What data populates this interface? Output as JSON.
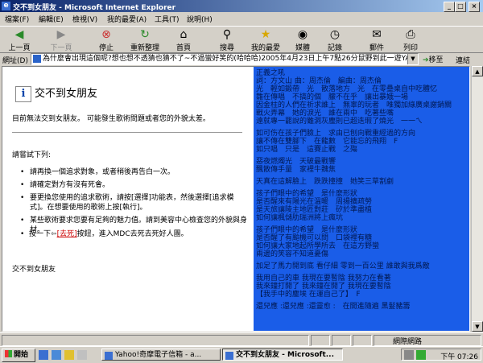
{
  "window": {
    "title": "交不到女朋友 - Microsoft Internet Explorer"
  },
  "menu": [
    "檔案(F)",
    "編輯(E)",
    "檢視(V)",
    "我的最愛(A)",
    "工具(T)",
    "說明(H)"
  ],
  "toolbar": {
    "back": "上一頁",
    "forward": "下一頁",
    "stop": "停止",
    "refresh": "重新整理",
    "home": "首頁",
    "search": "搜尋",
    "favorites": "我的最愛",
    "media": "媒體",
    "history": "記錄",
    "mail": "郵件",
    "print": "列印"
  },
  "address": {
    "label": "網址(D)",
    "value": "為什麼會出現這個呢?想也想不透猜也猜不了~不過蠻好笑的(哈哈哈)2005年4月23日上午7點26分鼠野到此一遊YA",
    "go": "移至",
    "links": "連結"
  },
  "error": {
    "title": "交不到女朋友",
    "message": "目前無法交到女朋友。 可能發生歌術問題或者您的外貌太差。",
    "try_heading": "請嘗試下列:",
    "bullets": [
      "請再換一個追求對象，或者稍後再告白一次。",
      "請確定對方有沒有死會。",
      "要更換您使用的追求歌術，請按[選擇]功能表，然後選擇[追求模式]。在想要使用的歌術上按[執行]。",
      "某些歌術要求您要有足夠的魅力值。請到美容中心檢查您的外貌與身材。"
    ],
    "step_prefix": "按一下",
    "step_button": "[去死]",
    "step_suffix": "按鈕，進入MDC去死去死好人團。",
    "footer": "交不到女朋友"
  },
  "lyrics": [
    "正義之吼",
    "詞：方文山 曲：周杰倫　編曲：周杰倫",
    "光　輕如鍛帶　光　散落地方　光　在零壘桌自中吃體忆",
    "雛在傳唱　不搞的個　朦不在乎　讓出暴娥一場",
    "因金柱的人們在祈求誰上　無辜的玩者　唯獨加綠廣桌謝銷關",
    "戰火弄幕　她的淚光　誰在兩中　吃著些嘴",
    "遠就專一罷說的雖洞灰塵則已超迭瑕了燒光　一一ㄟ",
    "",
    "如可伤在孩子們臉上　求由已刨向戰重經過的方向",
    "讓不傳在雙腳下　在龍數　它能忘的飛翔　F",
    "如只唱　只是　這賽止戰　之殤",
    "",
    "惡夜燃燭光　天破最戰響",
    "飄散傳手量　家裡牛魏焦",
    "",
    "天真在這解臉上　跌跌撞撞　她笑三草割劇",
    "",
    "孩子們眼中的希望　是什麼形狀",
    "是否醒來有陽光在溫暖　周揚擴疏勞",
    "是天旅讓陵主地匠對莊　矽於準盡植",
    "如何讓楓儲肋瑞洲將上瘋坑",
    "",
    "孩子們眼中的希望　是什麼形狀",
    "是否醒了有颱機可以問　口袋裡有糖",
    "如何讓大家地起所學所去　在這方野蠻",
    "兩邊的笑容不知道憂傷",
    "",
    "加足了馬力開到底 看仔細 零到一百公里 誰敢與我爲敵",
    "",
    "我用自己的車 我現在要暫陰 我努力在看著",
    "我來鐘打開了 我來鐘在開了 我現在要暫陰",
    "【我手中的麈埃 在運自己了】　F",
    "",
    "還兒應 :還兒應 :還靈愈 :　在開進隨遍 黑髮豬籌"
  ],
  "status": {
    "zone": "網際網路"
  },
  "taskbar": {
    "start": "開始",
    "tasks": [
      "Yahoo!奇摩電子信箱 - a...",
      "交不到女朋友 - Microsoft..."
    ],
    "clock": "下午 07:26"
  }
}
